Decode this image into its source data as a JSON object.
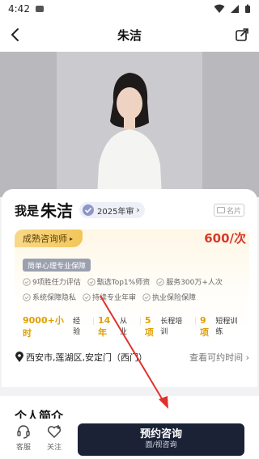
{
  "status_bar": {
    "time": "4:42"
  },
  "nav": {
    "title": "朱洁"
  },
  "profile": {
    "name_prefix": "我是",
    "name": "朱洁",
    "review_badge": "2025年审",
    "card_label": "名片",
    "level": "成熟咨询师",
    "price": "600/次",
    "service_tag": "简单心理专业保障",
    "guarantees": [
      "9项胜任力评估",
      "甄选Top1%师资",
      "服务300万+人次",
      "系统保障隐私",
      "持续专业年审",
      "执业保险保障"
    ],
    "stats": [
      {
        "num": "9000+小时",
        "label": "经验"
      },
      {
        "num": "14年",
        "label": "从业"
      },
      {
        "num": "5项",
        "label": "长程培训"
      },
      {
        "num": "9项",
        "label": "短程训练"
      }
    ],
    "address": "西安市,莲湖区,安定门（西门）",
    "availability_link": "查看可约时间"
  },
  "intro": {
    "title": "个人简介"
  },
  "bottom_bar": {
    "service_label": "客服",
    "follow_label": "关注",
    "cta_main": "预约咨询",
    "cta_sub": "面/视咨询"
  },
  "colors": {
    "accent_gold": "#e0a000",
    "price_red": "#d63a2a",
    "cta_bg": "#1b2236",
    "annotation_arrow": "#e0322b"
  }
}
